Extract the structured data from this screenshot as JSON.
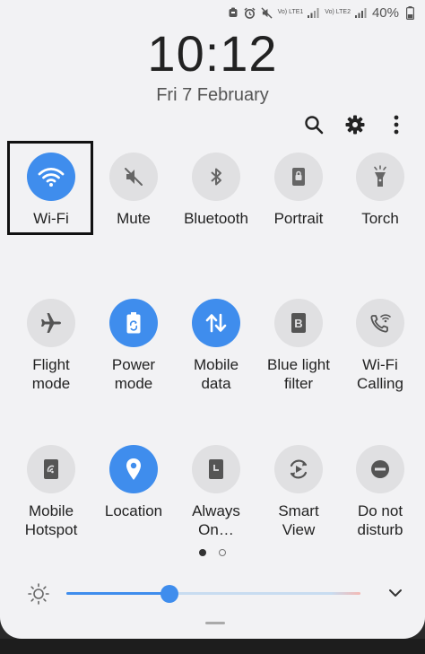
{
  "status_bar": {
    "lte1_label": "Vo) LTE1",
    "lte2_label": "Vo) LTE2",
    "battery": "40%",
    "icons": [
      "notification-icon",
      "alarm-icon",
      "mute-icon",
      "signal-1-icon",
      "signal-2-icon"
    ]
  },
  "clock": {
    "time": "10:12",
    "date": "Fri 7 February"
  },
  "top_actions": [
    "search-icon",
    "gear-icon",
    "more-vert-icon"
  ],
  "tiles": [
    {
      "label": "Wi-Fi",
      "active": true,
      "icon": "wifi-icon"
    },
    {
      "label": "Mute",
      "active": false,
      "icon": "mute-icon"
    },
    {
      "label": "Bluetooth",
      "active": false,
      "icon": "bluetooth-icon"
    },
    {
      "label": "Portrait",
      "active": false,
      "icon": "rotation-lock-icon"
    },
    {
      "label": "Torch",
      "active": false,
      "icon": "torch-icon"
    },
    {
      "label_lines": [
        "Flight",
        "mode"
      ],
      "active": false,
      "icon": "airplane-icon"
    },
    {
      "label_lines": [
        "Power",
        "mode"
      ],
      "active": true,
      "icon": "battery-recycle-icon"
    },
    {
      "label_lines": [
        "Mobile",
        "data"
      ],
      "active": true,
      "icon": "data-arrows-icon"
    },
    {
      "label_lines": [
        "Blue light",
        "filter"
      ],
      "active": false,
      "icon": "blue-light-icon"
    },
    {
      "label_lines": [
        "Wi-Fi",
        "Calling"
      ],
      "active": false,
      "icon": "wifi-calling-icon"
    },
    {
      "label_lines": [
        "Mobile",
        "Hotspot"
      ],
      "active": false,
      "icon": "hotspot-icon"
    },
    {
      "label": "Location",
      "active": true,
      "icon": "location-pin-icon"
    },
    {
      "label_lines": [
        "Always",
        "On…"
      ],
      "active": false,
      "icon": "always-on-display-icon"
    },
    {
      "label_lines": [
        "Smart",
        "View"
      ],
      "active": false,
      "icon": "smart-view-icon"
    },
    {
      "label_lines": [
        "Do not",
        "disturb"
      ],
      "active": false,
      "icon": "do-not-disturb-icon"
    }
  ],
  "page_indicator": {
    "current": 1,
    "total": 2
  },
  "brightness": {
    "level": 0.35
  },
  "colors": {
    "accent": "#3f8ded",
    "tile_off": "#e0e0e2",
    "panel_bg": "#f2f2f4"
  }
}
